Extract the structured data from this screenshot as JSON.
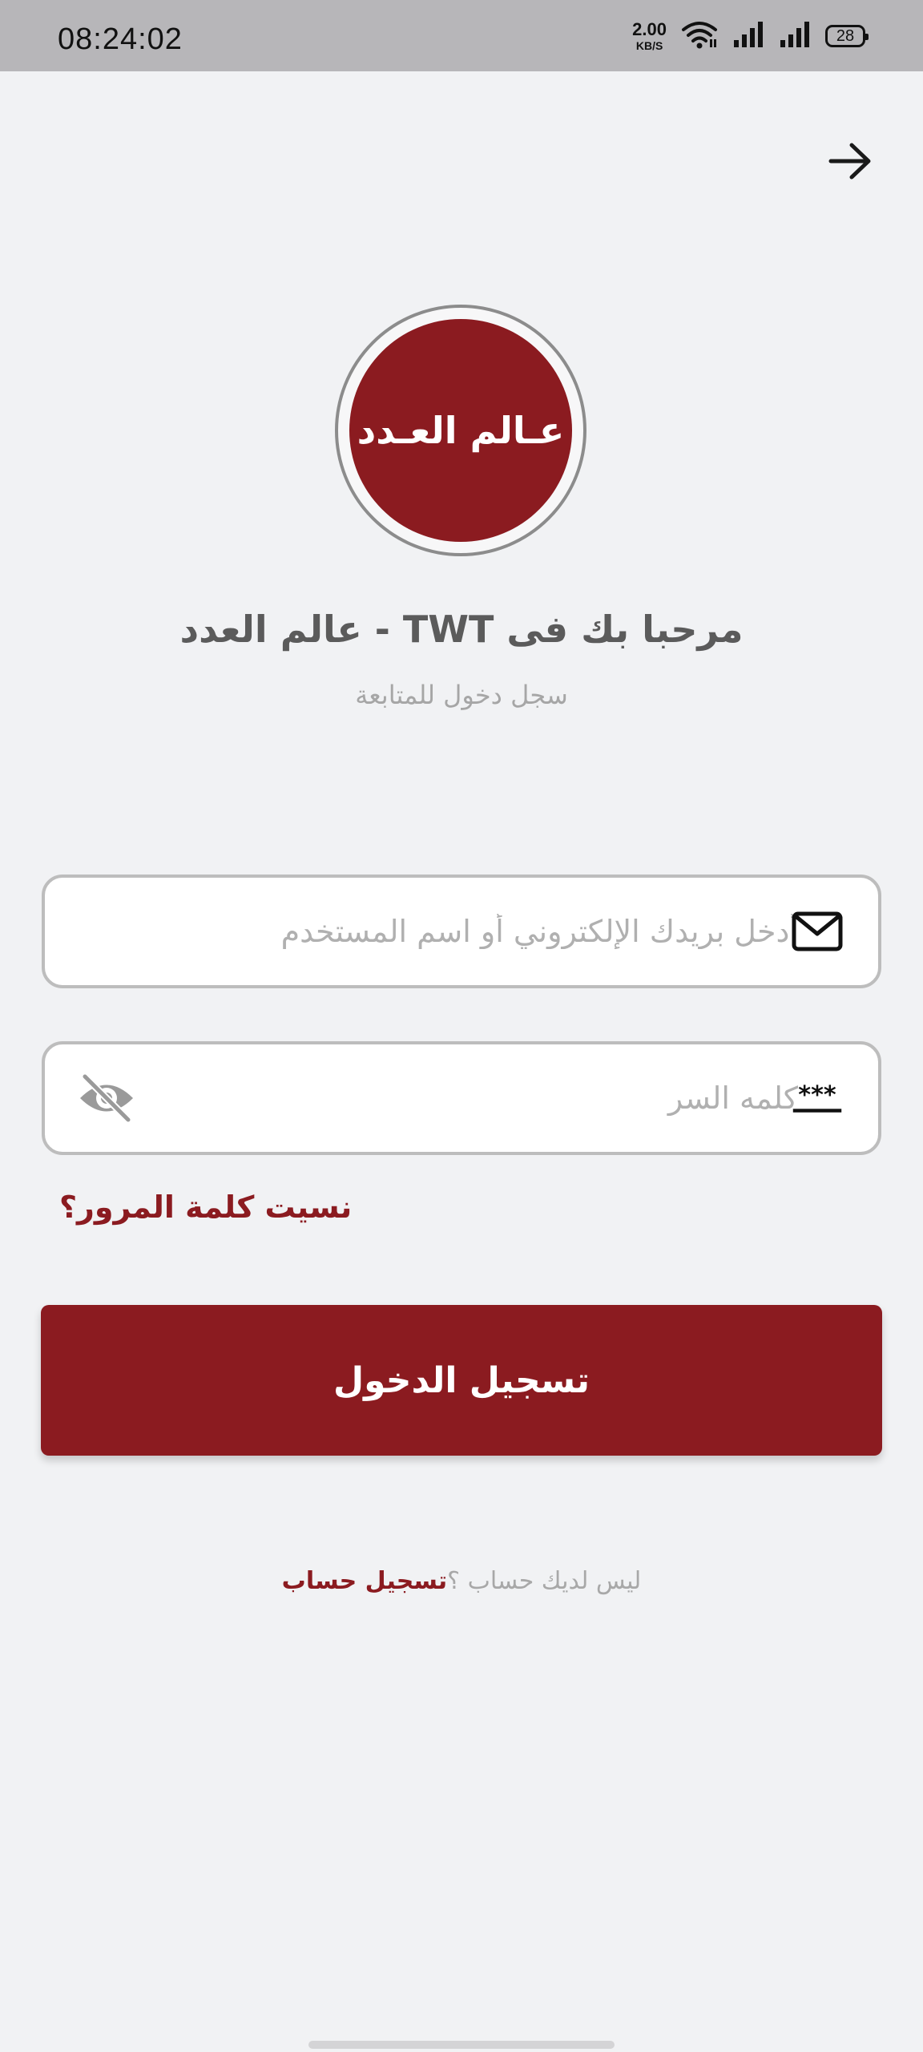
{
  "status_bar": {
    "time": "08:24:02",
    "net_speed_value": "2.00",
    "net_speed_unit": "KB/S",
    "battery": "28",
    "icons": [
      "wifi-icon",
      "signal-icon",
      "signal-icon",
      "battery-icon"
    ]
  },
  "header": {
    "forward_icon": "arrow-right-icon"
  },
  "logo": {
    "text": "عـالم العـدد",
    "colors": {
      "fill": "#8b1b20",
      "ring": "#8c8c8c"
    }
  },
  "welcome": {
    "title": "مرحبا بك فى TWT - عالم العدد",
    "subtitle": "سجل دخول للمتابعة"
  },
  "form": {
    "email": {
      "placeholder": "أدخل بريدك الإلكتروني أو اسم المستخدم",
      "value": "",
      "icon": "mail-icon"
    },
    "password": {
      "placeholder": "كلمه السر",
      "value": "",
      "icon": "password-icon",
      "toggle_icon": "eye-off-icon"
    },
    "forgot_password": "نسيت كلمة المرور؟",
    "login_button": "تسجيل الدخول"
  },
  "signup": {
    "prompt": "ليس لديك حساب ؟",
    "link": "تسجيل حساب"
  },
  "colors": {
    "accent": "#8b1b20",
    "background": "#f1f2f4",
    "status_bar": "#b7b6b9"
  }
}
